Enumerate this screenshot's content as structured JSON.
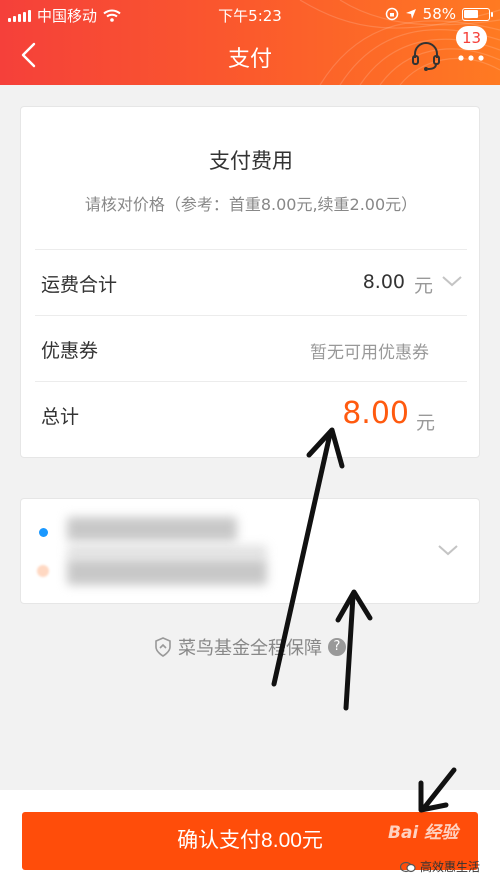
{
  "status_bar": {
    "carrier": "中国移动",
    "time": "下午5:23",
    "battery": "58%",
    "battery_level": 0.58
  },
  "nav": {
    "title": "支付",
    "badge_count": "13",
    "icons": [
      "back-icon",
      "headset-icon",
      "more-icon"
    ]
  },
  "payment": {
    "title": "支付费用",
    "subtitle": "请核对价格（参考：首重8.00元,续重2.00元）",
    "shipping_label": "运费合计",
    "shipping_value": "8.00",
    "shipping_unit": "元",
    "coupon_label": "优惠券",
    "coupon_hint": "暂无可用优惠券",
    "total_label": "总计",
    "total_value": "8.00",
    "total_unit": "元"
  },
  "guarantee": {
    "text": "菜鸟基金全程保障",
    "help": "?"
  },
  "confirm_button": "确认支付8.00元",
  "watermark": {
    "baidu": "Bai 经验",
    "account": "高效惠生活"
  },
  "colors": {
    "header_start": "#f5403a",
    "header_end": "#ff7a22",
    "accent": "#ff4d0a",
    "total": "#ff5a0f"
  }
}
